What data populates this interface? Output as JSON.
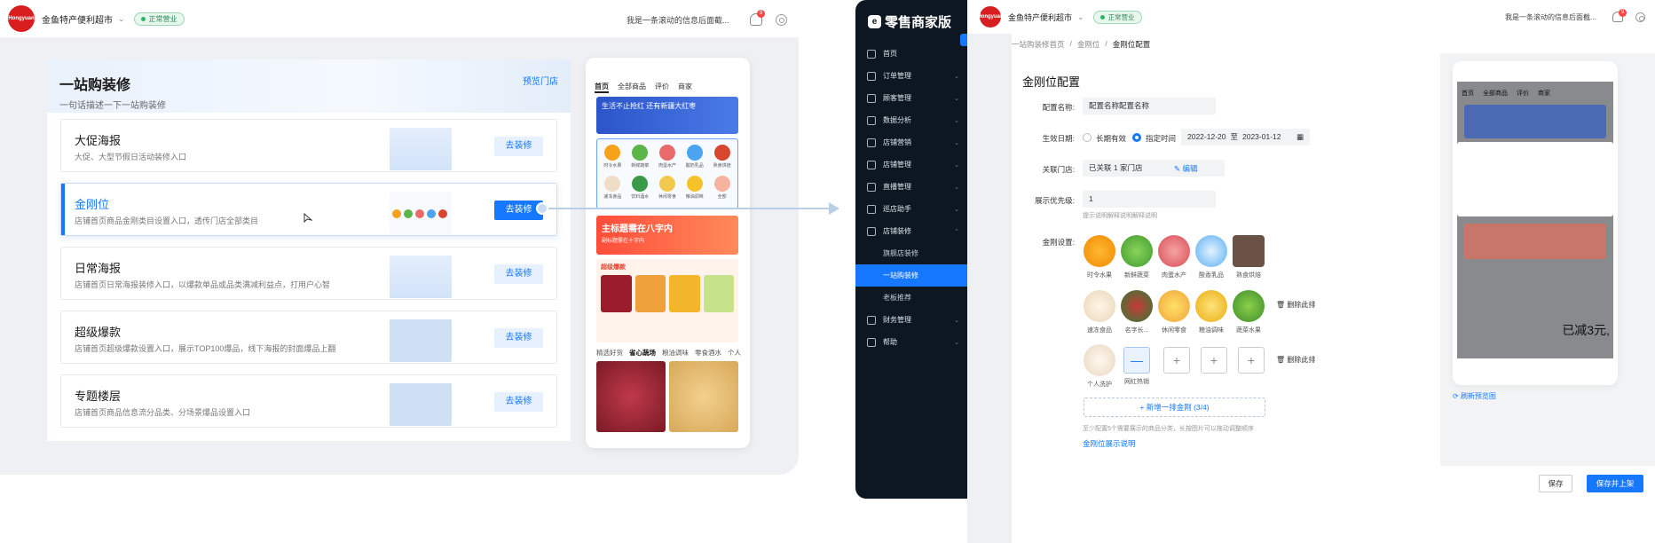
{
  "left": {
    "logo_text": "Hongyuan",
    "shop_name": "金鱼特产便利超市",
    "status": "正常营业",
    "ticker": "我是一条滚动的信息后面截...",
    "notif_count": "9",
    "hero": {
      "title": "一站购装修",
      "subtitle": "一句话描述一下一站购装修",
      "preview_link": "预览门店"
    },
    "cards": [
      {
        "title": "大促海报",
        "desc": "大促、大型节假日活动装修入口",
        "btn": "去装修"
      },
      {
        "title": "金刚位",
        "desc": "店铺首页商品金刚类目设置入口，透传门店全部类目",
        "btn": "去装修"
      },
      {
        "title": "日常海报",
        "desc": "店铺首页日常海报装修入口，以爆款单品或品类满减利益点，打用户心智",
        "btn": "去装修"
      },
      {
        "title": "超级爆款",
        "desc": "店铺首页超级爆款设置入口，展示TOP100爆品，线下海报的封面爆品上翻",
        "btn": "去装修"
      },
      {
        "title": "专题楼层",
        "desc": "店铺首页商品信息流分品类、分场景爆品设置入口",
        "btn": "去装修"
      }
    ],
    "phone": {
      "tabs": [
        "首页",
        "全部商品",
        "评价",
        "商家"
      ],
      "banner": "生活不止抢红 还有新疆大红枣",
      "grid": [
        "时令水果",
        "新鲜蔬菜",
        "肉蛋水产",
        "酸奶乳品",
        "熟食烘焙",
        "速冻食品",
        "饮料酒水",
        "休闲零食",
        "粮油调味",
        "全部"
      ],
      "promo_title": "主标题需在八字内",
      "promo_sub": "副标题需在十字内",
      "flash_title": "超级爆款",
      "tabs2": [
        "精选好货",
        "省心蔬场",
        "粮油调味",
        "零食酒水",
        "个人"
      ]
    }
  },
  "app": {
    "brand": "零售商家版",
    "brand_icon": "e",
    "nav": [
      {
        "label": "首页"
      },
      {
        "label": "订单管理",
        "chev": "⌄"
      },
      {
        "label": "顾客管理",
        "chev": "⌄"
      },
      {
        "label": "数据分析",
        "chev": "⌄"
      },
      {
        "label": "店铺营销",
        "chev": "⌄"
      },
      {
        "label": "店铺管理",
        "chev": "⌄"
      },
      {
        "label": "直播管理",
        "chev": "⌄"
      },
      {
        "label": "巡店助手",
        "chev": "⌄"
      },
      {
        "label": "店铺装修",
        "chev": "⌃"
      },
      {
        "label": "旗舰店装修",
        "sub": true
      },
      {
        "label": "一站购装修",
        "sub": true,
        "selected": true
      },
      {
        "label": "老板推荐",
        "sub": true
      },
      {
        "label": "财务管理",
        "chev": "⌄"
      },
      {
        "label": "帮助",
        "chev": "⌄"
      }
    ],
    "top": {
      "logo_text": "Hongyuan",
      "shop_name": "金鱼特产便利超市",
      "status": "正常营业",
      "ticker": "我是一条滚动的信息后面截...",
      "notif_count": "9"
    },
    "breadcrumbs": [
      "一站购装修首页",
      "金刚位",
      "金刚位配置"
    ],
    "form": {
      "title": "金刚位配置",
      "name_label": "配置名称:",
      "name_value": "配置名称配置名称",
      "date_label": "生效日期:",
      "date_opt1": "长期有效",
      "date_opt2": "指定时间",
      "date_start": "2022-12-20",
      "date_to": "至",
      "date_end": "2023-01-12",
      "store_label": "关联门店:",
      "store_value": "已关联 1 家门店",
      "store_edit": "编辑",
      "priority_label": "展示优先级:",
      "priority_value": "1",
      "priority_hint": "提示说明解释说明解释说明",
      "kk_label": "金刚设置:",
      "row1": [
        "时令水果",
        "新鲜蔬菜",
        "肉蛋水产",
        "酸香乳品",
        "熟食烘焙"
      ],
      "row2": [
        "速冻食品",
        "名字长...",
        "休闲零食",
        "粮油调味",
        "蔬菜水果"
      ],
      "row3": [
        "个人洗护",
        "网红热销"
      ],
      "delete": "删除此排",
      "add_row": "+ 新增一排金刚 (3/4)",
      "add_hint": "至少配置5个需要展示的商品分类，长按图片可以拖动调整顺序",
      "explain_link": "金刚位展示说明"
    },
    "preview": {
      "tabs": [
        "首页",
        "全部商品",
        "评价",
        "商家"
      ],
      "refresh": "刷新预览图",
      "reduce": "已减3元,"
    },
    "buttons": {
      "save": "保存",
      "save_publish": "保存并上架"
    }
  },
  "colors": {
    "accent": "#1677ff",
    "sidebar": "#0c1722",
    "brand_red": "#d81e1e"
  }
}
